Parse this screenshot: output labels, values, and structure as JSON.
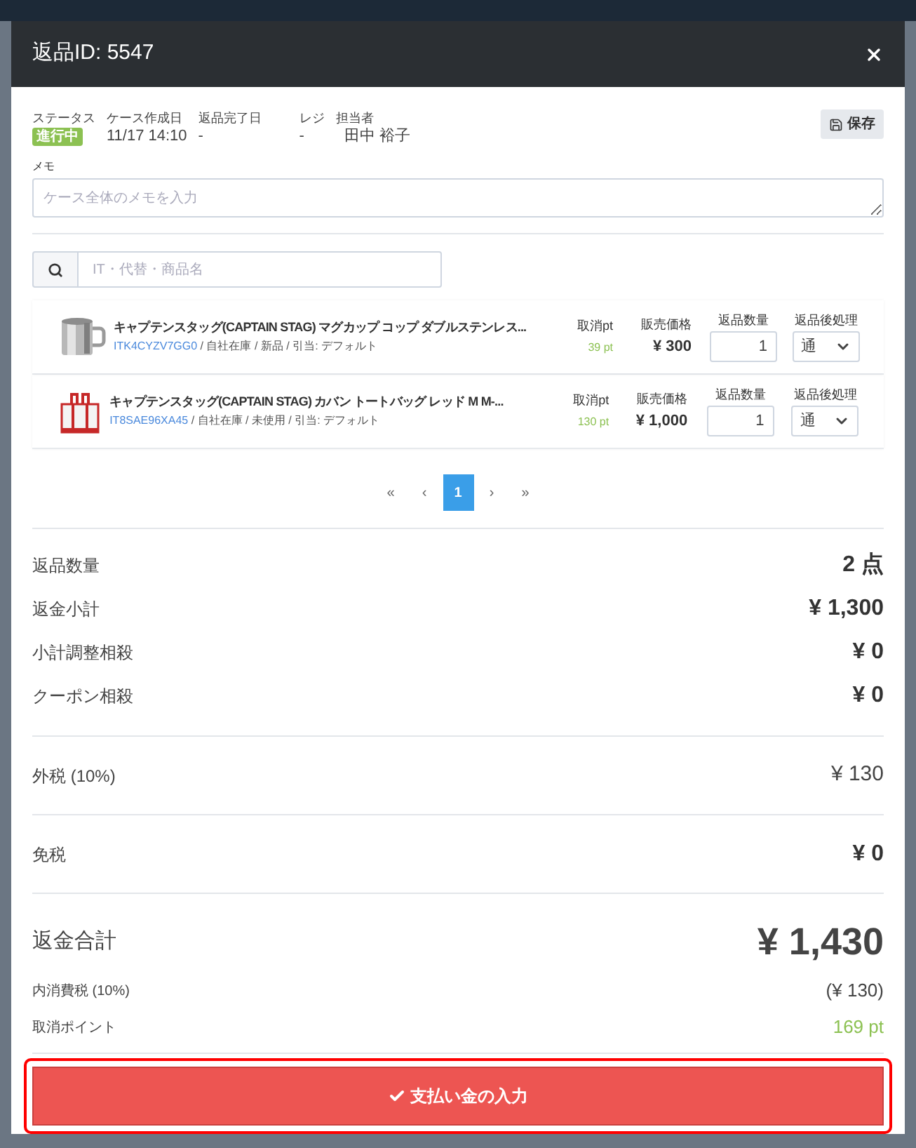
{
  "modal": {
    "title": "返品ID: 5547"
  },
  "meta": [
    {
      "label": "ステータス",
      "value": "進行中",
      "kind": "badge"
    },
    {
      "label": "ケース作成日",
      "value": "11/17 14:10",
      "kind": "text"
    },
    {
      "label": "返品完了日",
      "value": "-",
      "kind": "text"
    },
    {
      "label": "レジ",
      "value": "-",
      "kind": "text"
    },
    {
      "label": "担当者",
      "value": "田中 裕子",
      "kind": "text"
    }
  ],
  "save_button": "保存",
  "memo": {
    "label": "メモ",
    "placeholder": "ケース全体のメモを入力"
  },
  "search": {
    "placeholder": "IT・代替・商品名"
  },
  "items": [
    {
      "kind": "mug",
      "name": "キャプテンスタッグ(CAPTAIN STAG) マグカップ コップ ダブルステンレス...",
      "code": "ITK4CYZV7GG0",
      "details": " / 自社在庫 / 新品 / 引当: デフォルト",
      "points_label": "取消pt",
      "points": "39 pt",
      "price_label": "販売価格",
      "price": "¥ 300",
      "qty_label": "返品数量",
      "qty": "1",
      "action_label": "返品後処理",
      "action": "通"
    },
    {
      "kind": "bag",
      "name": "キャプテンスタッグ(CAPTAIN STAG) カバン トートバッグ レッド M M-...",
      "code": "IT8SAE96XA45",
      "details": " / 自社在庫 / 未使用 / 引当: デフォルト",
      "points_label": "取消pt",
      "points": "130 pt",
      "price_label": "販売価格",
      "price": "¥ 1,000",
      "qty_label": "返品数量",
      "qty": "1",
      "action_label": "返品後処理",
      "action": "通"
    }
  ],
  "pagination": [
    {
      "label": "«",
      "selected": false
    },
    {
      "label": "‹",
      "selected": false
    },
    {
      "label": "1",
      "selected": true
    },
    {
      "label": "›",
      "selected": false
    },
    {
      "label": "»",
      "selected": false
    }
  ],
  "summary_groups": [
    [
      {
        "label": "返品数量",
        "value": "2 点",
        "kind": "bold"
      },
      {
        "label": "返金小計",
        "value": "¥ 1,300",
        "kind": "bold"
      },
      {
        "label": "小計調整相殺",
        "value": "¥ 0",
        "kind": "bold"
      },
      {
        "label": "クーポン相殺",
        "value": "¥ 0",
        "kind": "bold"
      }
    ],
    [
      {
        "label": "外税 (10%)",
        "value": "¥ 130",
        "kind": "plain"
      }
    ],
    [
      {
        "label": "免税",
        "value": "¥ 0",
        "kind": "bold"
      }
    ]
  ],
  "total": {
    "label": "返金合計",
    "value": "¥ 1,430"
  },
  "tax_included": {
    "label": "内消費税 (10%)",
    "value": "(¥ 130)"
  },
  "points": {
    "label": "取消ポイント",
    "value": "169 pt"
  },
  "pay_button": "支払い金の入力"
}
